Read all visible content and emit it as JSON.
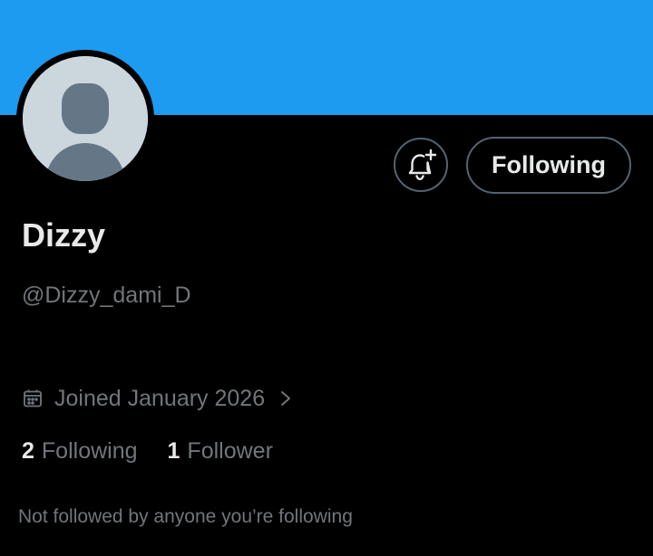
{
  "profile": {
    "display_name": "Dizzy",
    "handle": "@Dizzy_dami_D",
    "joined": "Joined January 2026",
    "follow_button_label": "Following",
    "following_count": "2",
    "following_label": "Following",
    "followers_count": "1",
    "followers_label": "Follower",
    "not_followed_text": "Not followed by anyone you’re following"
  },
  "icons": {
    "bell": "bell-plus-icon",
    "calendar": "calendar-icon",
    "chevron": "chevron-right-icon",
    "avatar": "default-avatar-silhouette"
  },
  "colors": {
    "banner": "#1d9bf0",
    "background": "#000000",
    "text_primary": "#e7e9ea",
    "text_secondary": "#71767b",
    "button_border": "#536471",
    "avatar_bg": "#ccd6dd",
    "avatar_figure": "#657786"
  }
}
